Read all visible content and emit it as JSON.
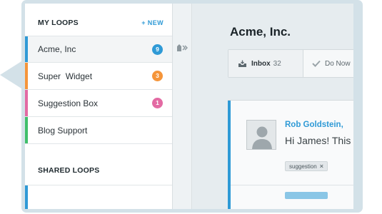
{
  "sidebar": {
    "my_loops_title": "MY LOOPS",
    "new_label": "+ NEW",
    "loops": [
      {
        "name": "Acme, Inc",
        "count": "9",
        "bar_color": "#2f9ad6",
        "badge_color": "#2f9ad6",
        "active": true
      },
      {
        "name": "Super  Widget",
        "count": "3",
        "bar_color": "#f5953a",
        "badge_color": "#f5953a",
        "active": false
      },
      {
        "name": "Suggestion Box",
        "count": "1",
        "bar_color": "#e36aa3",
        "badge_color": "#e36aa3",
        "active": false
      },
      {
        "name": "Blog Support",
        "count": "",
        "bar_color": "#3fbf6a",
        "badge_color": "",
        "active": false
      }
    ],
    "shared_loops_title": "SHARED LOOPS"
  },
  "main": {
    "title": "Acme, Inc.",
    "tabs": {
      "inbox_label": "Inbox",
      "inbox_count": "32",
      "donow_label": "Do Now"
    },
    "message": {
      "author": "Rob Goldstein,",
      "preview": "Hi James! This",
      "tag": "suggestion",
      "tag_remove": "×"
    }
  },
  "colors": {
    "accent": "#2f9ad6",
    "frame": "#d3e1e8"
  },
  "icons": {
    "collapse": "collapse-sidebar-icon",
    "inbox": "inbox-tray-icon",
    "donow": "checkmark-icon",
    "avatar": "default-user-icon"
  }
}
